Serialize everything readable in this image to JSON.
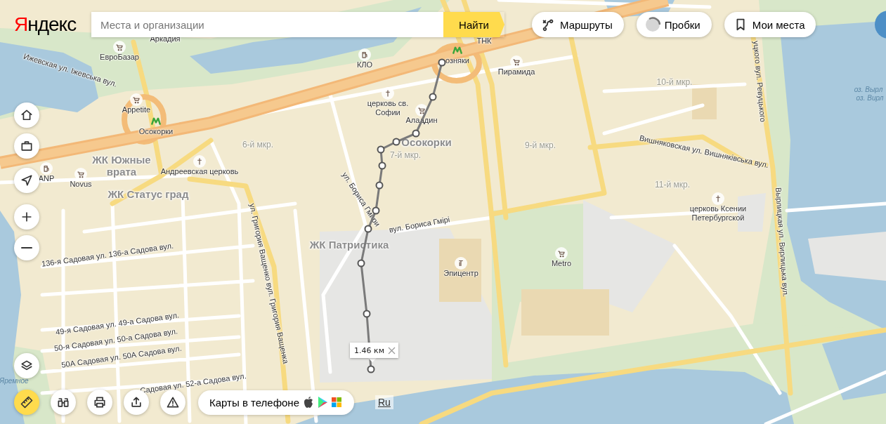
{
  "logo": {
    "text": "Яндекс"
  },
  "search": {
    "placeholder": "Места и организации",
    "button": "Найти"
  },
  "top_buttons": [
    {
      "kind": "routes",
      "label": "Маршруты"
    },
    {
      "kind": "traffic",
      "label": "Пробки"
    },
    {
      "kind": "places",
      "label": "Мои места"
    }
  ],
  "side_controls": [
    {
      "kind": "home"
    },
    {
      "kind": "work"
    },
    {
      "kind": "locate"
    },
    {
      "kind": "zoom_in"
    },
    {
      "kind": "zoom_out"
    },
    {
      "kind": "layers"
    }
  ],
  "bottom_tools": [
    {
      "kind": "ruler",
      "selected": true
    },
    {
      "kind": "panorama",
      "selected": false
    },
    {
      "kind": "print",
      "selected": false
    },
    {
      "kind": "share",
      "selected": false
    },
    {
      "kind": "report",
      "selected": false
    }
  ],
  "app_promo": {
    "label": "Карты в телефоне"
  },
  "language": "Ru",
  "measurement": {
    "distance": "1.46 км"
  },
  "map_labels": [
    {
      "kind": "place",
      "text": "Аркадия"
    },
    {
      "kind": "place",
      "text": "ТНК"
    },
    {
      "kind": "street",
      "text": "Ижевская ул. Іжевська вул."
    },
    {
      "kind": "district",
      "text": "ЖК Южные врата"
    },
    {
      "kind": "district",
      "text": "ЖК Статус град"
    },
    {
      "kind": "micro",
      "text": "6-й мкр."
    },
    {
      "kind": "micro",
      "text": "7-й мкр."
    },
    {
      "kind": "district",
      "text": "Осокорки"
    },
    {
      "kind": "micro",
      "text": "9-й мкр."
    },
    {
      "kind": "micro",
      "text": "10-й мкр."
    },
    {
      "kind": "micro",
      "text": "11-й мкр."
    },
    {
      "kind": "street",
      "text": "Вишняковская ул. Вишняківська вул."
    },
    {
      "kind": "street",
      "text": "уцкого вул. Ревуцького"
    },
    {
      "kind": "street",
      "text": "Вырлицкая ул. Вирлицька вул."
    },
    {
      "kind": "water",
      "text": "оз. Вырл"
    },
    {
      "kind": "water",
      "text": "оз. Вирл"
    },
    {
      "kind": "street",
      "text": "ул. Бориса Гмири"
    },
    {
      "kind": "street",
      "text": "вул. Бориса Гмірі"
    },
    {
      "kind": "district",
      "text": "ЖК Патристика"
    },
    {
      "kind": "street",
      "text": "ул. Григория Ващенко вул. Григория Ващенка"
    },
    {
      "kind": "street",
      "text": "136-я Садовая ул. 136-а Садова вул."
    },
    {
      "kind": "street",
      "text": "49-я Садовая ул. 49-а Садова вул."
    },
    {
      "kind": "street",
      "text": "50-я Садовая ул. 50-а Садова вул."
    },
    {
      "kind": "street",
      "text": "50А Садовая ул. 50А Садова вул."
    },
    {
      "kind": "street",
      "text": "Садовая ул. 52-а Садова вул."
    },
    {
      "kind": "water",
      "text": "Яремное"
    }
  ],
  "pois": [
    {
      "kind": "shop",
      "name": "ЕвроБазар"
    },
    {
      "kind": "shop",
      "name": "Appetite"
    },
    {
      "kind": "metro",
      "name": "Осокорки"
    },
    {
      "kind": "fuel",
      "name": "ANP"
    },
    {
      "kind": "shop",
      "name": "Novus"
    },
    {
      "kind": "church",
      "name": "Андреевская церковь"
    },
    {
      "kind": "fuel",
      "name": "КЛО"
    },
    {
      "kind": "metro",
      "name": "озняки"
    },
    {
      "kind": "shop",
      "name": "Пирамида"
    },
    {
      "kind": "church",
      "name": "церковь св. Софии"
    },
    {
      "kind": "shop",
      "name": "Аладдин"
    },
    {
      "kind": "church",
      "name": "церковь Ксении Петербургской"
    },
    {
      "kind": "hardware",
      "name": "Эпицентр"
    },
    {
      "kind": "shop",
      "name": "Metro"
    }
  ]
}
